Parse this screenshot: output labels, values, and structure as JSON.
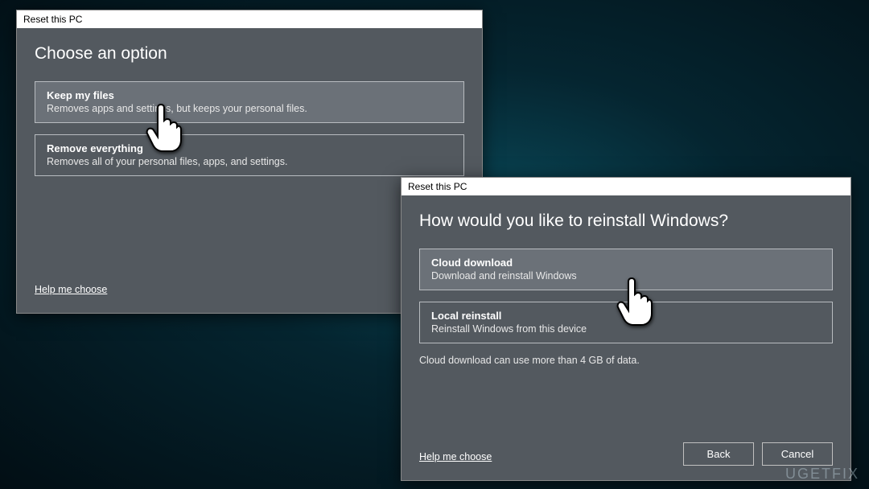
{
  "dialog1": {
    "titlebar": "Reset this PC",
    "heading": "Choose an option",
    "options": [
      {
        "title": "Keep my files",
        "desc": "Removes apps and settings, but keeps your personal files."
      },
      {
        "title": "Remove everything",
        "desc": "Removes all of your personal files, apps, and settings."
      }
    ],
    "help_link": "Help me choose"
  },
  "dialog2": {
    "titlebar": "Reset this PC",
    "heading": "How would you like to reinstall Windows?",
    "options": [
      {
        "title": "Cloud download",
        "desc": "Download and reinstall Windows"
      },
      {
        "title": "Local reinstall",
        "desc": "Reinstall Windows from this device"
      }
    ],
    "info": "Cloud download can use more than 4 GB of data.",
    "help_link": "Help me choose",
    "buttons": {
      "back": "Back",
      "cancel": "Cancel"
    }
  },
  "watermark": "UGETFIX"
}
